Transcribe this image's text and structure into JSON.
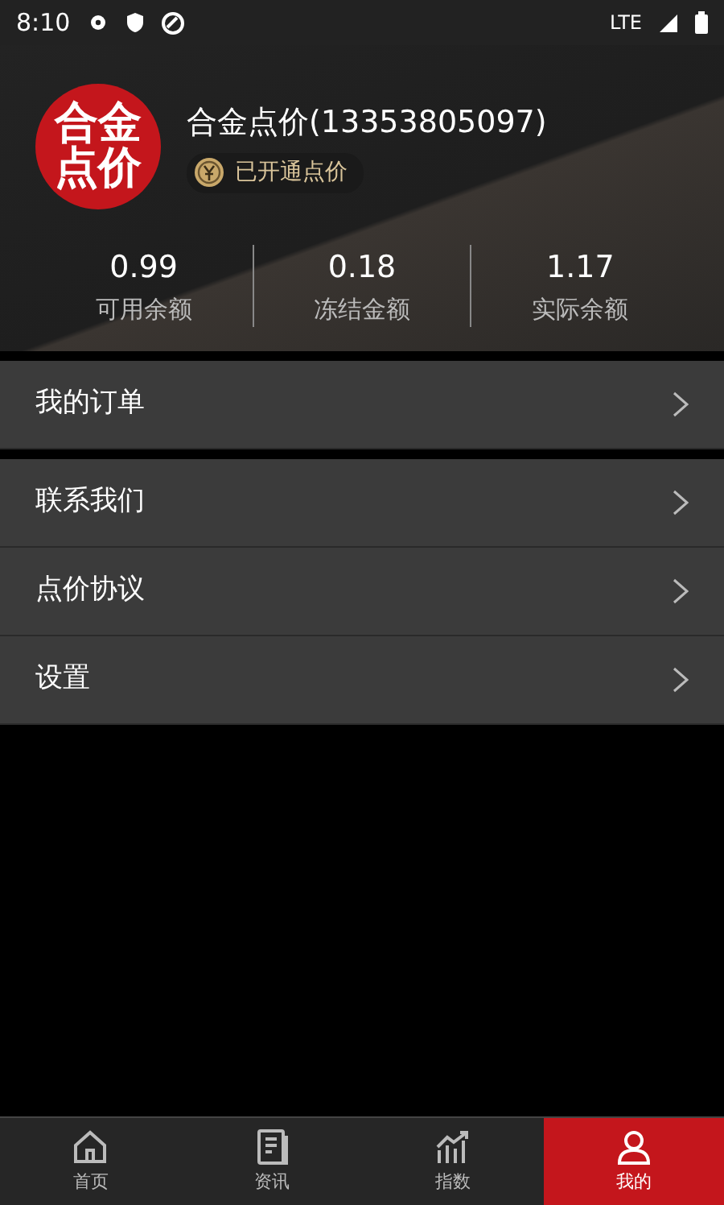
{
  "status_bar": {
    "time": "8:10",
    "network": "LTE"
  },
  "profile": {
    "logo_text": "合金点价",
    "name": "合金点价(13353805097)",
    "badge": "已开通点价"
  },
  "balances": [
    {
      "value": "0.99",
      "label": "可用余额"
    },
    {
      "value": "0.18",
      "label": "冻结金额"
    },
    {
      "value": "1.17",
      "label": "实际余额"
    }
  ],
  "menu_groups": [
    {
      "items": [
        {
          "label": "我的订单"
        }
      ]
    },
    {
      "items": [
        {
          "label": "联系我们"
        },
        {
          "label": "点价协议"
        },
        {
          "label": "设置"
        }
      ]
    }
  ],
  "bottom_nav": [
    {
      "label": "首页",
      "kind": "home",
      "selected": false
    },
    {
      "label": "资讯",
      "kind": "news",
      "selected": false
    },
    {
      "label": "指数",
      "kind": "chart",
      "selected": false
    },
    {
      "label": "我的",
      "kind": "user",
      "selected": true
    }
  ]
}
